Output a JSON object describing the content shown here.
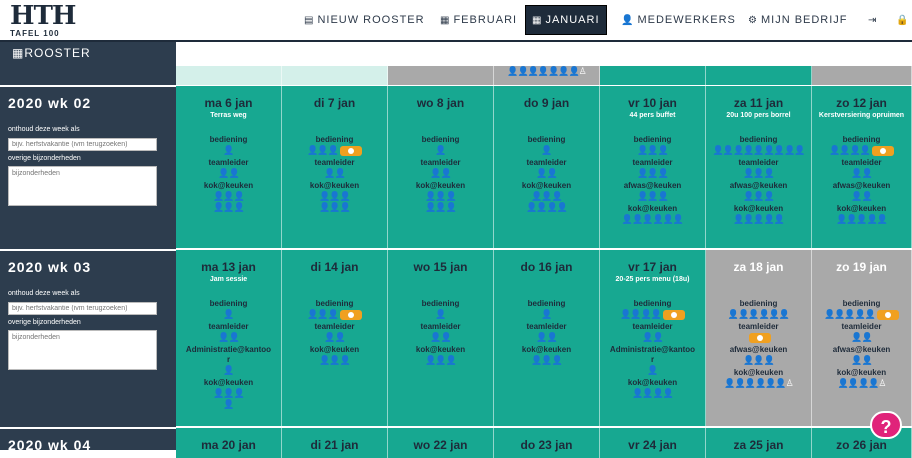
{
  "logo": {
    "big": "HTH",
    "small": "TAFEL 100"
  },
  "nav": [
    {
      "icon": "▤",
      "label": "NIEUW ROOSTER"
    },
    {
      "icon": "▦",
      "label": "FEBRUARI"
    },
    {
      "icon": "▦",
      "label": "JANUARI"
    },
    {
      "icon": "👤",
      "label": "MEDEWERKERS"
    },
    {
      "icon": "⚙",
      "label": "MIJN BEDRIJF"
    },
    {
      "icon": "⇥",
      "label": ""
    },
    {
      "icon": "🔒",
      "label": ""
    }
  ],
  "sidebar": {
    "title": "ROOSTER",
    "title_icon": "▦"
  },
  "prev_row_people": "👤👤👤👤👤👤👤♙",
  "labels": {
    "remember": "onthoud deze week als",
    "details": "overige bijzonderheden",
    "remember_placeholder": "bijv. herfstvakantie (ivm terugzoeken)",
    "details_placeholder": "bijzonderheden"
  },
  "weeks": [
    {
      "label": "2020 wk 02",
      "days": [
        {
          "date": "ma 6 jan",
          "note": "Terras weg",
          "style": "teal",
          "roles": [
            {
              "name": "bediening",
              "people": "👤",
              "badge": false
            },
            {
              "name": "teamleider",
              "people": "👤👤",
              "badge": false
            },
            {
              "name": "kok@keuken",
              "people": "👤👤👤\n👤👤👤",
              "badge": false
            }
          ]
        },
        {
          "date": "di 7 jan",
          "note": "",
          "style": "teal",
          "roles": [
            {
              "name": "bediening",
              "people": "👤👤👤",
              "badge": true
            },
            {
              "name": "teamleider",
              "people": "👤👤",
              "badge": false
            },
            {
              "name": "kok@keuken",
              "people": "👤👤👤\n👤👤👤",
              "badge": false
            }
          ]
        },
        {
          "date": "wo 8 jan",
          "note": "",
          "style": "teal",
          "roles": [
            {
              "name": "bediening",
              "people": "👤",
              "badge": false
            },
            {
              "name": "teamleider",
              "people": "👤👤",
              "badge": false
            },
            {
              "name": "kok@keuken",
              "people": "👤👤👤\n👤👤👤",
              "badge": false
            }
          ]
        },
        {
          "date": "do 9 jan",
          "note": "",
          "style": "teal",
          "roles": [
            {
              "name": "bediening",
              "people": "👤",
              "badge": false
            },
            {
              "name": "teamleider",
              "people": "👤👤",
              "badge": false
            },
            {
              "name": "kok@keuken",
              "people": "👤👤👤\n👤👤👤👤",
              "badge": false
            }
          ]
        },
        {
          "date": "vr 10 jan",
          "note": "44 pers buffet",
          "style": "teal",
          "roles": [
            {
              "name": "bediening",
              "people": "👤👤👤",
              "badge": false
            },
            {
              "name": "teamleider",
              "people": "👤👤👤",
              "badge": false
            },
            {
              "name": "afwas@keuken",
              "people": "👤👤👤",
              "badge": false
            },
            {
              "name": "kok@keuken",
              "people": "👤👤👤👤👤👤",
              "badge": false
            }
          ]
        },
        {
          "date": "za 11 jan",
          "note": "20u 100 pers borrel",
          "style": "teal",
          "roles": [
            {
              "name": "bediening",
              "people": "👤👤👤👤👤👤👤👤👤",
              "badge": false
            },
            {
              "name": "teamleider",
              "people": "👤👤👤",
              "badge": false
            },
            {
              "name": "afwas@keuken",
              "people": "👤👤👤",
              "badge": false
            },
            {
              "name": "kok@keuken",
              "people": "👤👤👤👤👤",
              "badge": false
            }
          ]
        },
        {
          "date": "zo 12 jan",
          "note": "Kerstversiering opruimen",
          "style": "teal",
          "roles": [
            {
              "name": "bediening",
              "people": "👤👤👤👤",
              "badge": true
            },
            {
              "name": "teamleider",
              "people": "👤👤",
              "badge": false
            },
            {
              "name": "afwas@keuken",
              "people": "👤👤",
              "badge": false
            },
            {
              "name": "kok@keuken",
              "people": "👤👤👤👤👤",
              "badge": false
            }
          ]
        }
      ]
    },
    {
      "label": "2020 wk 03",
      "days": [
        {
          "date": "ma 13 jan",
          "note": "Jam sessie",
          "style": "teal",
          "roles": [
            {
              "name": "bediening",
              "people": "👤",
              "badge": false
            },
            {
              "name": "teamleider",
              "people": "👤👤",
              "badge": false
            },
            {
              "name": "Administratie@kantoo\nr",
              "people": "👤",
              "badge": false
            },
            {
              "name": "kok@keuken",
              "people": "👤👤👤\n👤",
              "badge": false
            }
          ]
        },
        {
          "date": "di 14 jan",
          "note": "",
          "style": "teal",
          "roles": [
            {
              "name": "bediening",
              "people": "👤👤👤",
              "badge": true
            },
            {
              "name": "teamleider",
              "people": "👤👤",
              "badge": false
            },
            {
              "name": "kok@keuken",
              "people": "👤👤👤",
              "badge": false
            }
          ]
        },
        {
          "date": "wo 15 jan",
          "note": "",
          "style": "teal",
          "roles": [
            {
              "name": "bediening",
              "people": "👤",
              "badge": false
            },
            {
              "name": "teamleider",
              "people": "👤👤",
              "badge": false
            },
            {
              "name": "kok@keuken",
              "people": "👤👤👤",
              "badge": false
            }
          ]
        },
        {
          "date": "do 16 jan",
          "note": "",
          "style": "teal",
          "roles": [
            {
              "name": "bediening",
              "people": "👤",
              "badge": false
            },
            {
              "name": "teamleider",
              "people": "👤👤",
              "badge": false
            },
            {
              "name": "kok@keuken",
              "people": "👤👤👤",
              "badge": false
            }
          ]
        },
        {
          "date": "vr 17 jan",
          "note": "20-25 pers menu (18u)",
          "style": "teal",
          "roles": [
            {
              "name": "bediening",
              "people": "👤👤👤👤",
              "badge": true
            },
            {
              "name": "teamleider",
              "people": "👤👤",
              "badge": false
            },
            {
              "name": "Administratie@kantoo\nr",
              "people": "👤",
              "badge": false
            },
            {
              "name": "kok@keuken",
              "people": "👤👤👤👤",
              "badge": false
            }
          ]
        },
        {
          "date": "za 18 jan",
          "note": "",
          "style": "grey",
          "roles": [
            {
              "name": "bediening",
              "people": "👤👤👤👤👤👤",
              "badge": false
            },
            {
              "name": "teamleider",
              "people": "",
              "badge": true
            },
            {
              "name": "afwas@keuken",
              "people": "👤👤👤",
              "badge": false
            },
            {
              "name": "kok@keuken",
              "people": "👤👤👤👤👤👤♙",
              "badge": false
            }
          ]
        },
        {
          "date": "zo 19 jan",
          "note": "",
          "style": "grey",
          "roles": [
            {
              "name": "bediening",
              "people": "👤👤👤👤👤",
              "badge": true
            },
            {
              "name": "teamleider",
              "people": "👤👤",
              "badge": false
            },
            {
              "name": "afwas@keuken",
              "people": "👤👤",
              "badge": false
            },
            {
              "name": "kok@keuken",
              "people": "👤👤👤👤♙",
              "badge": false
            }
          ]
        }
      ]
    },
    {
      "label": "2020 wk 04",
      "days": [
        {
          "date": "ma 20 jan",
          "style": "teal"
        },
        {
          "date": "di 21 jan",
          "style": "teal"
        },
        {
          "date": "wo 22 jan",
          "style": "teal"
        },
        {
          "date": "do 23 jan",
          "style": "teal"
        },
        {
          "date": "vr 24 jan",
          "style": "teal"
        },
        {
          "date": "za 25 jan",
          "style": "teal"
        },
        {
          "date": "zo 26 jan",
          "style": "teal"
        }
      ]
    }
  ],
  "help_label": "?"
}
